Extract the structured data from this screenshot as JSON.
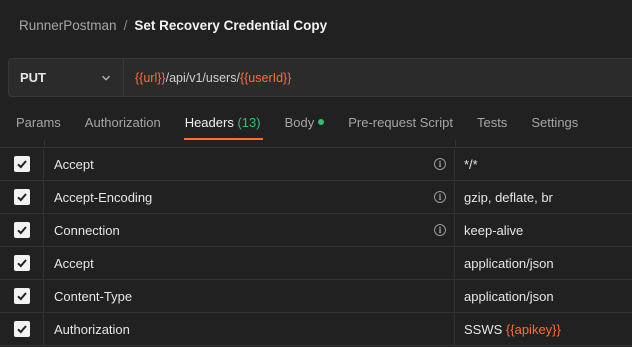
{
  "breadcrumb": {
    "parent": "RunnerPostman",
    "separator": "/",
    "current": "Set Recovery Credential Copy"
  },
  "request": {
    "method": "PUT",
    "url_parts": [
      {
        "text": "{{url}}",
        "is_var": true
      },
      {
        "text": "/api/v1/users/",
        "is_var": false
      },
      {
        "text": "{{userId}}",
        "is_var": true
      }
    ]
  },
  "tabs": [
    {
      "label": "Params",
      "active": false
    },
    {
      "label": "Authorization",
      "active": false
    },
    {
      "label": "Headers",
      "count": "(13)",
      "active": true
    },
    {
      "label": "Body",
      "has_dot": true,
      "active": false
    },
    {
      "label": "Pre-request Script",
      "active": false
    },
    {
      "label": "Tests",
      "active": false
    },
    {
      "label": "Settings",
      "active": false
    }
  ],
  "headers": [
    {
      "checked": true,
      "key": "Accept",
      "info": true,
      "value": "*/*"
    },
    {
      "checked": true,
      "key": "Accept-Encoding",
      "info": true,
      "value": "gzip, deflate, br"
    },
    {
      "checked": true,
      "key": "Connection",
      "info": true,
      "value": "keep-alive"
    },
    {
      "checked": true,
      "key": "Accept",
      "info": false,
      "value": "application/json"
    },
    {
      "checked": true,
      "key": "Content-Type",
      "info": false,
      "value": "application/json"
    },
    {
      "checked": true,
      "key": "Authorization",
      "info": false,
      "value_prefix": "SSWS ",
      "value_var": "{{apikey}}"
    }
  ],
  "colors": {
    "accent": "#ff6c37",
    "success": "#2fbf71",
    "background": "#212121"
  }
}
